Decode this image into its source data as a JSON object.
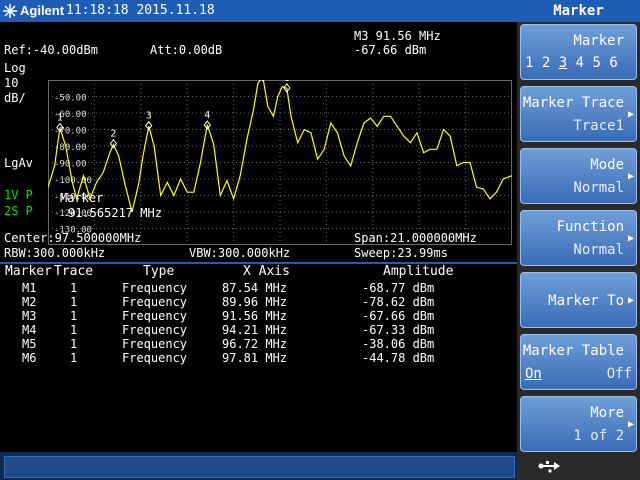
{
  "header": {
    "brand": "Agilent",
    "datetime": "11:18:18 2015.11.18"
  },
  "panel_title": "Marker",
  "display": {
    "ref": "Ref:-40.00dBm",
    "att": "Att:0.00dB",
    "marker_readout_freq": "M3 91.56 MHz",
    "marker_readout_amp": "-67.66 dBm",
    "scale_log": "Log",
    "scale_value": "10",
    "scale_unit": "dB/",
    "lgav": "LgAv",
    "trace_1v": "1V P",
    "trace_2s": "2S P",
    "marker_label": "Marker",
    "marker_value": "91.565217 MHz",
    "center": "Center:97.500000MHz",
    "span": "Span:21.000000MHz",
    "rbw": "RBW:300.000kHz",
    "vbw": "VBW:300.000kHz",
    "sweep": "Sweep:23.99ms",
    "y_ticks": [
      "-50.00",
      "-60.00",
      "-70.00",
      "-80.00",
      "-90.00",
      "-100.00",
      "-110.00",
      "-120.00",
      "-130.00"
    ]
  },
  "marker_table": {
    "headers": [
      "Marker",
      "Trace",
      "Type",
      "X Axis",
      "Amplitude"
    ],
    "rows": [
      {
        "marker": "M1",
        "trace": "1",
        "type": "Frequency",
        "x": "87.54 MHz",
        "amp": "-68.77 dBm"
      },
      {
        "marker": "M2",
        "trace": "1",
        "type": "Frequency",
        "x": "89.96 MHz",
        "amp": "-78.62 dBm"
      },
      {
        "marker": "M3",
        "trace": "1",
        "type": "Frequency",
        "x": "91.56 MHz",
        "amp": "-67.66 dBm"
      },
      {
        "marker": "M4",
        "trace": "1",
        "type": "Frequency",
        "x": "94.21 MHz",
        "amp": "-67.33 dBm"
      },
      {
        "marker": "M5",
        "trace": "1",
        "type": "Frequency",
        "x": "96.72 MHz",
        "amp": "-38.06 dBm"
      },
      {
        "marker": "M6",
        "trace": "1",
        "type": "Frequency",
        "x": "97.81 MHz",
        "amp": "-44.78 dBm"
      }
    ]
  },
  "softkeys": {
    "marker": {
      "label": "Marker",
      "options": [
        "1",
        "2",
        "3",
        "4",
        "5",
        "6"
      ],
      "selected": "3"
    },
    "marker_trace": {
      "label": "Marker Trace",
      "value": "Trace1"
    },
    "mode": {
      "label": "Mode",
      "value": "Normal"
    },
    "function": {
      "label": "Function",
      "value": "Normal"
    },
    "marker_to": {
      "label": "Marker To"
    },
    "marker_table": {
      "label": "Marker Table",
      "on": "On",
      "off": "Off",
      "selected": "On"
    },
    "more": {
      "label": "More",
      "value": "1 of 2"
    }
  },
  "colors": {
    "trace": "#ffff00",
    "marker": "#ffffff",
    "accent": "#1e5db5",
    "grid": "#6a6a6a"
  },
  "chart_data": {
    "type": "line",
    "title": "",
    "xlabel": "",
    "ylabel": "",
    "xlim": [
      87.0,
      108.0
    ],
    "ylim": [
      -140,
      -40
    ],
    "y_unit": "dBm",
    "grid": true,
    "series": [
      {
        "x": [
          87.0,
          87.3,
          87.54,
          87.8,
          88.1,
          88.3,
          88.6,
          88.9,
          89.2,
          89.5,
          89.8,
          89.96,
          90.2,
          90.5,
          90.8,
          91.1,
          91.3,
          91.56,
          91.8,
          92.1,
          92.4,
          92.7,
          93.0,
          93.3,
          93.6,
          93.9,
          94.21,
          94.5,
          94.8,
          95.1,
          95.4,
          95.7,
          96.0,
          96.3,
          96.5,
          96.72,
          96.95,
          97.2,
          97.4,
          97.6,
          97.81,
          98.0,
          98.3,
          98.6,
          98.9,
          99.2,
          99.5,
          99.8,
          100.1,
          100.4,
          100.7,
          101.0,
          101.3,
          101.6,
          101.9,
          102.2,
          102.5,
          102.8,
          103.1,
          103.4,
          103.7,
          104.0,
          104.3,
          104.6,
          104.9,
          105.2,
          105.5,
          105.8,
          106.1,
          106.4,
          106.7,
          107.0,
          107.3,
          107.6,
          108.0
        ],
        "values": [
          -105,
          -92,
          -69,
          -80,
          -102,
          -112,
          -98,
          -112,
          -102,
          -96,
          -84,
          -79,
          -86,
          -104,
          -120,
          -103,
          -86,
          -68,
          -80,
          -110,
          -102,
          -110,
          -100,
          -108,
          -108,
          -90,
          -67,
          -79,
          -110,
          -101,
          -112,
          -98,
          -76,
          -58,
          -42,
          -38,
          -56,
          -62,
          -50,
          -44,
          -45,
          -62,
          -78,
          -70,
          -72,
          -88,
          -82,
          -66,
          -72,
          -86,
          -92,
          -78,
          -66,
          -63,
          -68,
          -62,
          -62,
          -68,
          -74,
          -78,
          -72,
          -84,
          -82,
          -82,
          -70,
          -74,
          -92,
          -90,
          -90,
          -105,
          -106,
          -112,
          -108,
          -100,
          -98
        ]
      }
    ],
    "markers": [
      {
        "label": "1",
        "x": 87.54,
        "y": -68.77
      },
      {
        "label": "2",
        "x": 89.96,
        "y": -78.62
      },
      {
        "label": "3",
        "x": 91.56,
        "y": -67.66
      },
      {
        "label": "4",
        "x": 94.21,
        "y": -67.33
      },
      {
        "label": "5",
        "x": 96.72,
        "y": -38.06
      },
      {
        "label": "6",
        "x": 97.81,
        "y": -44.78
      }
    ]
  }
}
